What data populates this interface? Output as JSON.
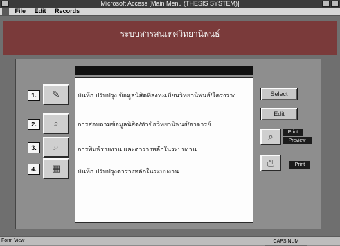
{
  "window": {
    "title": "Microsoft Access  [Main  Menu  (THESIS  SYSTEM)]"
  },
  "menubar": {
    "items": [
      "File",
      "Edit",
      "Records"
    ]
  },
  "header": {
    "banner_text": "ระบบสารสนเทศวิทยานิพนธ์"
  },
  "menu_rows": [
    {
      "number": "1.",
      "icon": "pencil-icon",
      "label": "บันทึก ปรับปรุง ข้อมูลนิสิตที่ลงทะเบียนวิทยานิพนธ์/โครงร่าง"
    },
    {
      "number": "2.",
      "icon": "binoculars-icon",
      "label": "การสอบถามข้อมูลนิสิต/หัวข้อวิทยานิพนธ์/อาจารย์"
    },
    {
      "number": "3.",
      "icon": "magnifier-icon",
      "label": "การพิมพ์รายงาน และตารางหลักในระบบงาน"
    },
    {
      "number": "4.",
      "icon": "table-icon",
      "label": "บันทึก ปรับปรุงตารางหลักในระบบงาน"
    }
  ],
  "buttons": {
    "select": "Select",
    "edit": "Edit"
  },
  "print": {
    "print_label": "Print",
    "preview_label": "Preview",
    "print2_label": "Print"
  },
  "statusbar": {
    "left": "Form View",
    "right": "CAPS  NUM"
  }
}
